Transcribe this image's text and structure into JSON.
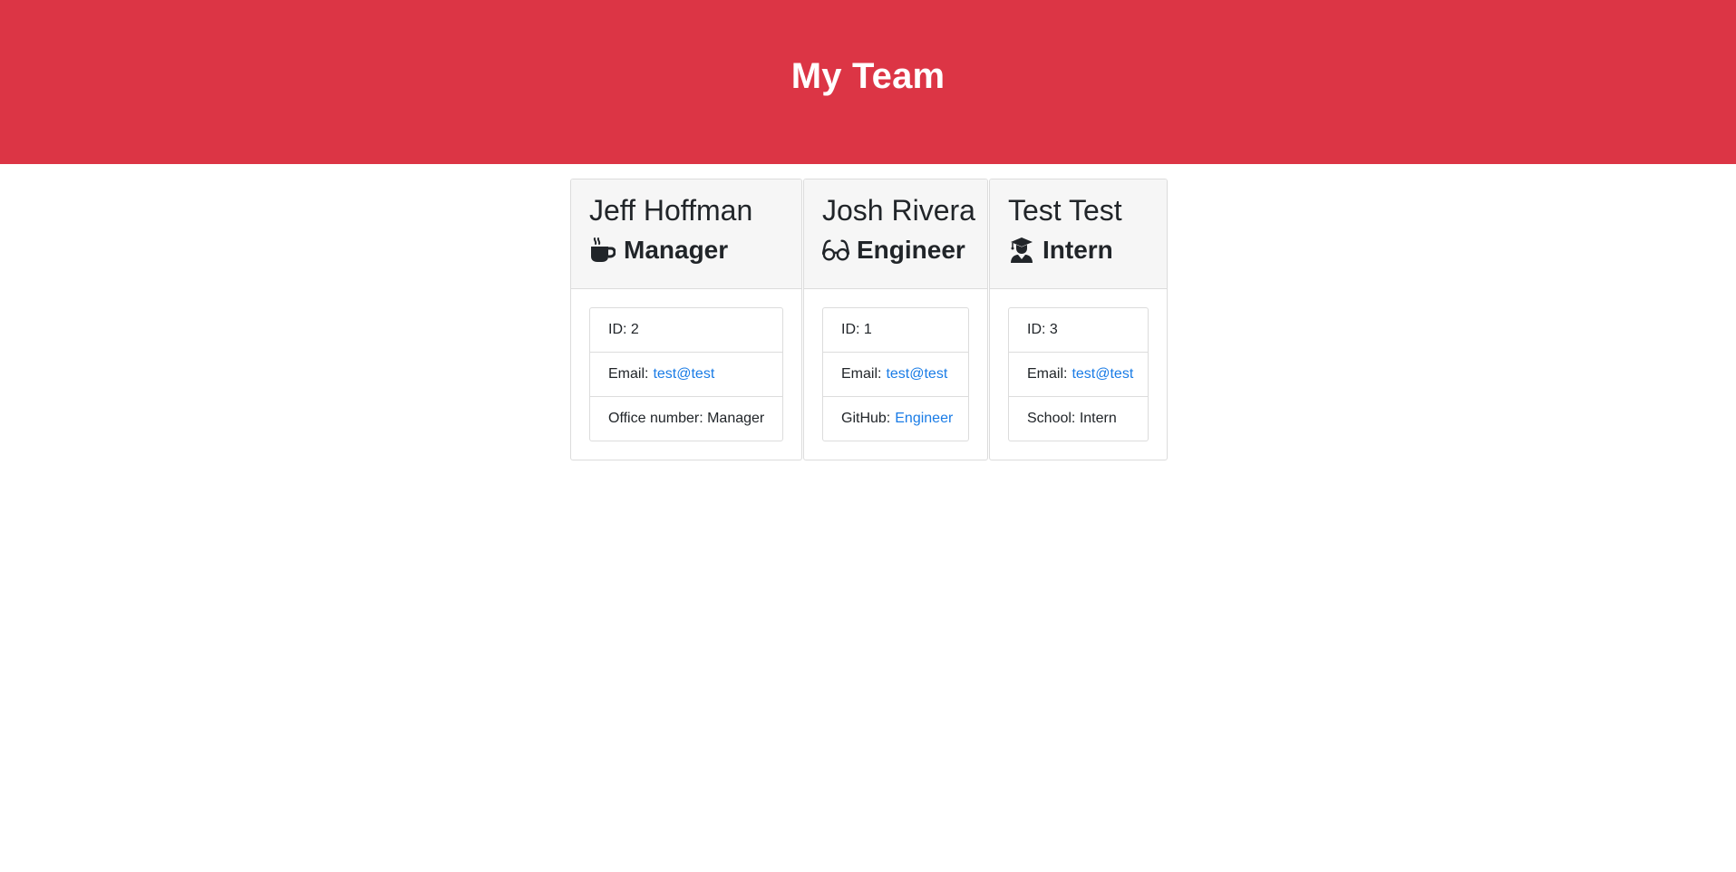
{
  "page": {
    "title": "My Team",
    "banner_color": "#dc3545",
    "link_color": "#1a7ce6"
  },
  "team": [
    {
      "name": "Jeff Hoffman",
      "role": "Manager",
      "icon": "coffee-mug-icon",
      "details": [
        {
          "label": "ID: 2",
          "value": ""
        },
        {
          "label": "Email:",
          "value": "test@test",
          "link": true
        },
        {
          "label": "Office number: Manager",
          "value": ""
        }
      ]
    },
    {
      "name": "Josh Rivera",
      "role": "Engineer",
      "icon": "glasses-icon",
      "details": [
        {
          "label": "ID: 1",
          "value": ""
        },
        {
          "label": "Email:",
          "value": "test@test",
          "link": true
        },
        {
          "label": "GitHub:",
          "value": "Engineer",
          "link": true
        }
      ]
    },
    {
      "name": "Test Test",
      "role": "Intern",
      "icon": "graduate-icon",
      "details": [
        {
          "label": "ID: 3",
          "value": ""
        },
        {
          "label": "Email:",
          "value": "test@test",
          "link": true
        },
        {
          "label": "School: Intern",
          "value": ""
        }
      ]
    }
  ]
}
